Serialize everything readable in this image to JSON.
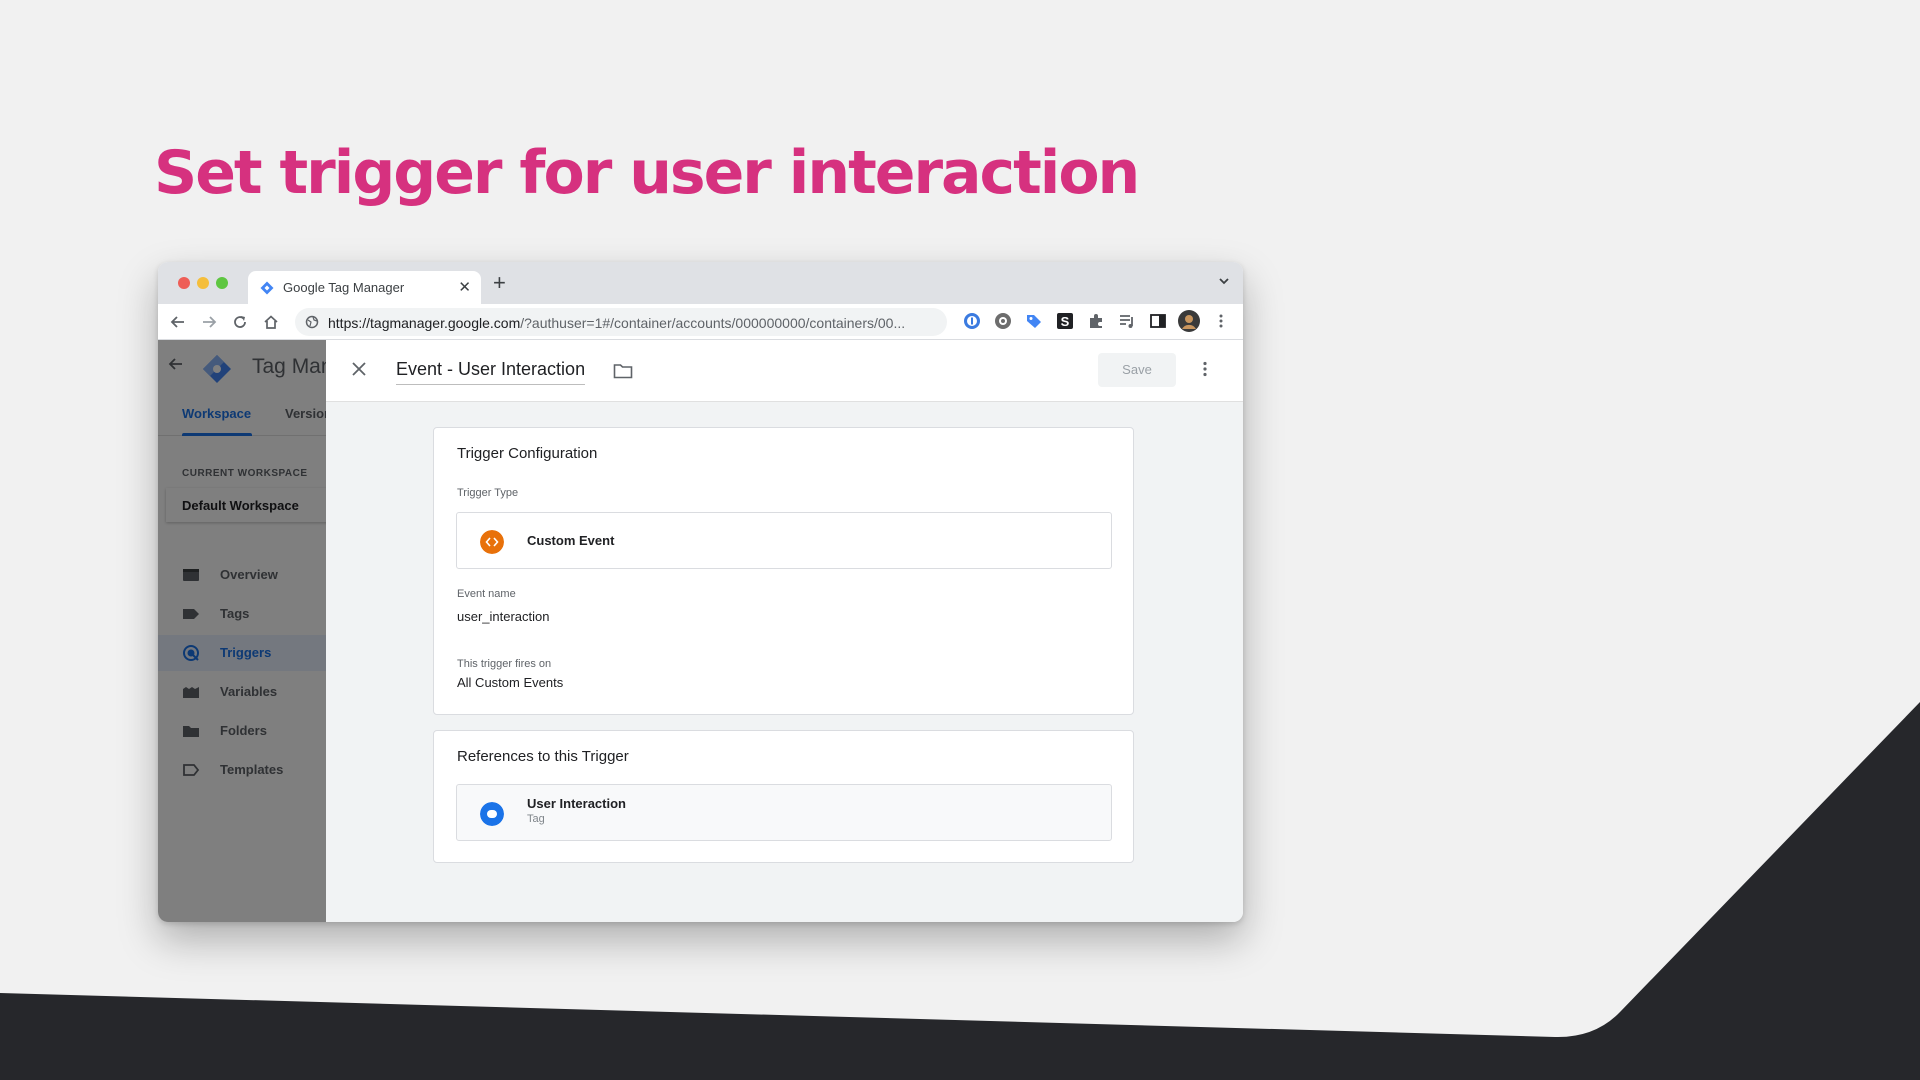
{
  "slide": {
    "title": "Set trigger for user interaction"
  },
  "browser": {
    "tab_title": "Google Tag Manager",
    "url_host": "https://tagmanager.google.com",
    "url_path": "/?authuser=1#/container/accounts/000000000/containers/00..."
  },
  "gtm": {
    "brand": "Tag Manager",
    "tabs": [
      {
        "label": "Workspace",
        "active": true
      },
      {
        "label": "Versions",
        "active": false
      }
    ],
    "current_workspace_label": "CURRENT WORKSPACE",
    "workspace_name": "Default Workspace",
    "nav": [
      {
        "label": "Overview",
        "icon": "overview-icon",
        "active": false
      },
      {
        "label": "Tags",
        "icon": "tag-icon",
        "active": false
      },
      {
        "label": "Triggers",
        "icon": "trigger-icon",
        "active": true
      },
      {
        "label": "Variables",
        "icon": "variables-icon",
        "active": false
      },
      {
        "label": "Folders",
        "icon": "folder-icon",
        "active": false
      },
      {
        "label": "Templates",
        "icon": "templates-icon",
        "active": false
      }
    ]
  },
  "editor": {
    "title": "Event - User Interaction",
    "save_label": "Save",
    "config_card": {
      "title": "Trigger Configuration",
      "type_label": "Trigger Type",
      "type_value": "Custom Event",
      "event_name_label": "Event name",
      "event_name_value": "user_interaction",
      "fires_on_label": "This trigger fires on",
      "fires_on_value": "All Custom Events"
    },
    "references_card": {
      "title": "References to this Trigger",
      "item_name": "User Interaction",
      "item_type": "Tag"
    }
  },
  "colors": {
    "title_pink": "#d6317f",
    "dark_shape": "#26272b",
    "gtm_blue": "#1a73e8",
    "custom_event_orange": "#e8710a"
  }
}
